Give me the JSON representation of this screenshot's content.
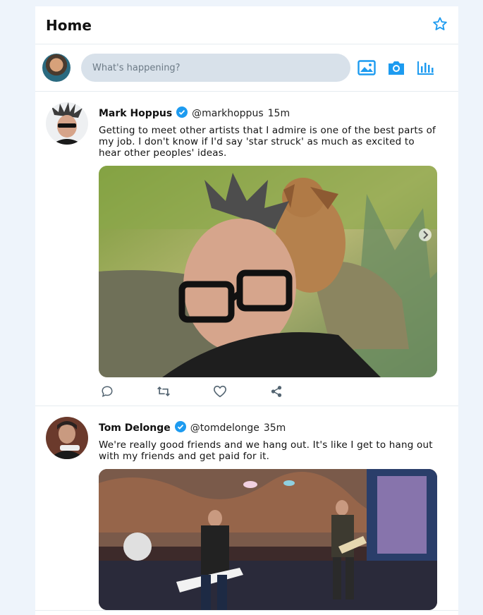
{
  "header": {
    "title": "Home"
  },
  "compose": {
    "placeholder": "What's happening?"
  },
  "tweets": [
    {
      "name": "Mark Hoppus",
      "handle": "@markhoppus",
      "time": "15m",
      "text": "Getting to meet other artists that I admire is one of the best parts of my job. I don't know if I'd say 'star struck' as much as excited to hear other peoples' ideas."
    },
    {
      "name": "Tom Delonge",
      "handle": "@tomdelonge",
      "time": "35m",
      "text": "We're really good friends and we hang out. It's like I get to hang out with my friends and get paid for it."
    }
  ],
  "colors": {
    "accent": "#1d9bf0",
    "icon_gray": "#536471"
  },
  "icons": [
    "star-icon",
    "image-icon",
    "camera-icon",
    "poll-icon",
    "reply-icon",
    "retweet-icon",
    "like-icon",
    "share-icon",
    "verified-icon"
  ]
}
